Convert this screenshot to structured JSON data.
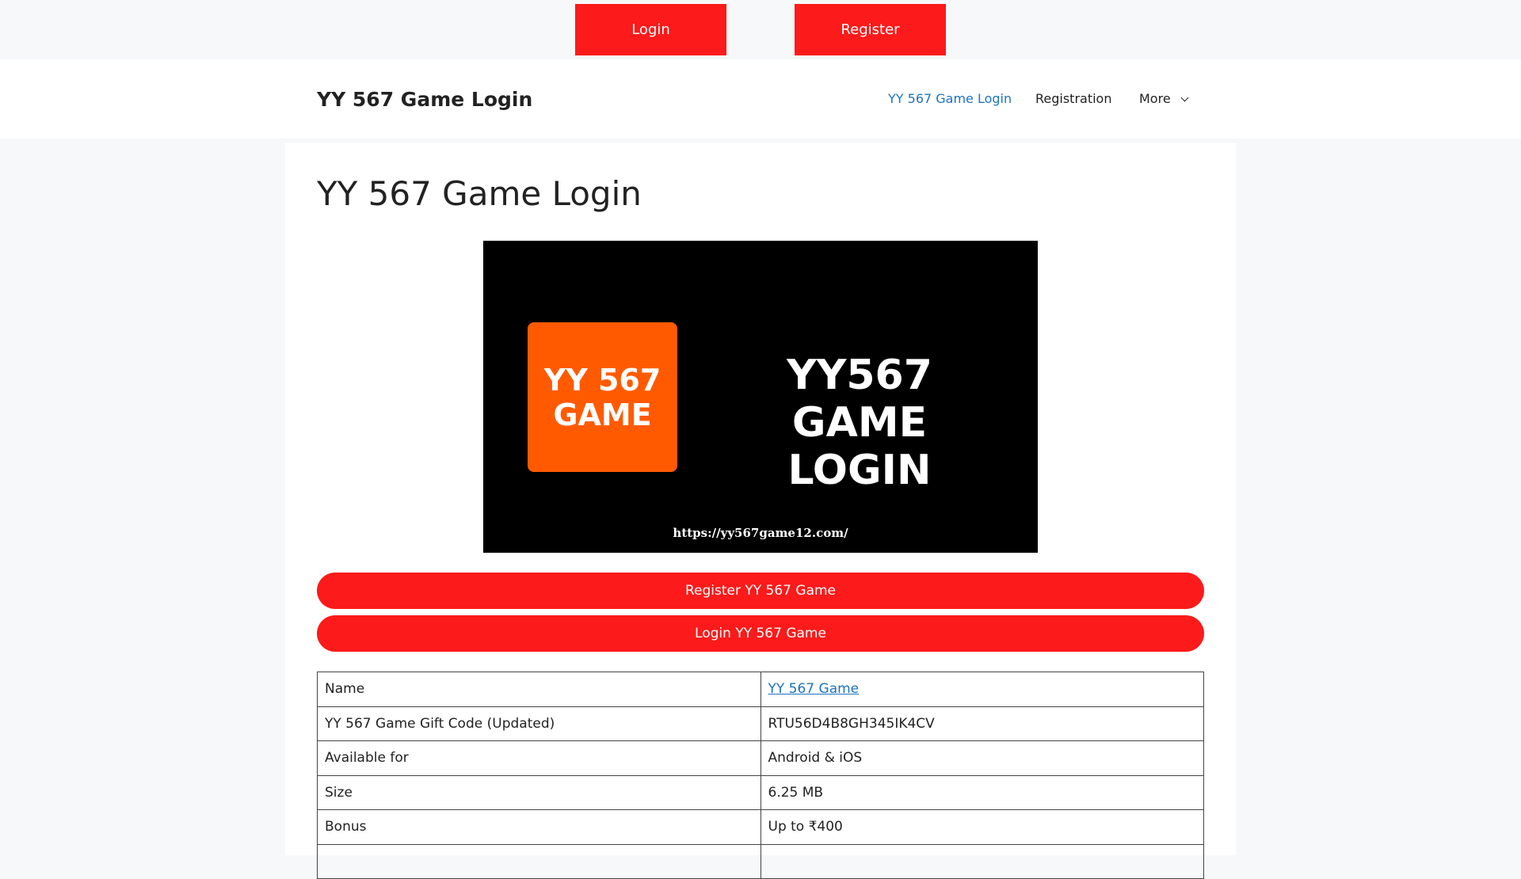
{
  "topbar": {
    "login_label": "Login",
    "register_label": "Register"
  },
  "header": {
    "site_title": "YY 567 Game Login",
    "nav": [
      {
        "label": "YY 567 Game Login"
      },
      {
        "label": "Registration"
      },
      {
        "label": "More"
      }
    ]
  },
  "main": {
    "page_title": "YY 567 Game Login",
    "banner": {
      "logo_line1": "YY 567",
      "logo_line2": "GAME",
      "heading_line1": "YY567 GAME",
      "heading_line2": "LOGIN",
      "url": "https://yy567game12.com/"
    },
    "register_button": "Register YY 567 Game",
    "login_button": "Login YY 567 Game",
    "table": [
      {
        "key": "Name",
        "value": "YY 567 Game"
      },
      {
        "key": "YY 567 Game Gift Code (Updated)",
        "value": "RTU56D4B8GH345IK4CV"
      },
      {
        "key": "Available for",
        "value": "Android & iOS"
      },
      {
        "key": "Size",
        "value": "6.25 MB"
      },
      {
        "key": "Bonus",
        "value": "Up to ₹400"
      },
      {
        "key": "",
        "value": ""
      }
    ]
  },
  "colors": {
    "accent_red": "#fc1a1a",
    "link_blue": "#1e73be",
    "logo_orange": "#ff5a00"
  }
}
